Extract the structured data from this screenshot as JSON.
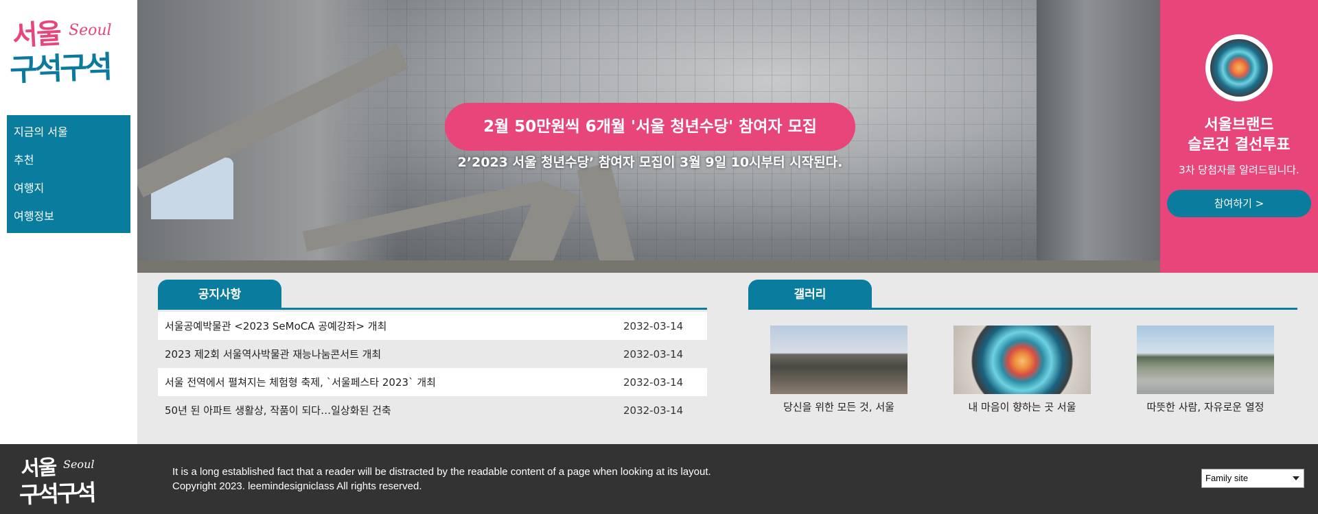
{
  "brand": {
    "logo_line1": "서울",
    "logo_line1_latin": "Seoul",
    "logo_line2": "구석구석"
  },
  "nav": {
    "items": [
      {
        "label": "지금의 서울"
      },
      {
        "label": "추천"
      },
      {
        "label": "여행지"
      },
      {
        "label": "여행정보"
      }
    ]
  },
  "hero": {
    "title": "2월 50만원씩 6개월 '서울 청년수당' 참여자 모집",
    "subtitle": "2’2023 서울 청년수당’ 참여자 모집이 3월 9일 10시부터 시작된다."
  },
  "promo": {
    "title_line1": "서울브랜드",
    "title_line2": "슬로건 결선투표",
    "description": "3차 당첨자를 알려드립니다.",
    "button_label": "참여하기 >"
  },
  "notice": {
    "tab_label": "공지사항",
    "items": [
      {
        "title": "서울공예박물관 <2023 SeMoCA 공예강좌> 개최",
        "date": "2032-03-14"
      },
      {
        "title": "2023 제2회 서울역사박물관 재능나눔콘서트 개최",
        "date": "2032-03-14"
      },
      {
        "title": "서울 전역에서 펼쳐지는 체험형 축제, `서울페스타 2023` 개최",
        "date": "2032-03-14"
      },
      {
        "title": "50년 된 아파트 생활상, 작품이 되다…일상화된 건축",
        "date": "2032-03-14"
      }
    ]
  },
  "gallery": {
    "tab_label": "갤러리",
    "items": [
      {
        "caption": "당신을 위한 모든 것, 서울"
      },
      {
        "caption": "내 마음이 향하는 곳 서울"
      },
      {
        "caption": "따뜻한 사람, 자유로운 열정"
      }
    ]
  },
  "footer": {
    "line1": "It is a long established fact that a reader will be distracted by the readable content of a page when looking at its layout.",
    "line2": "Copyright 2023. leemindesigniclass All rights reserved.",
    "family_site_label": "Family site"
  },
  "colors": {
    "teal": "#0a7d9f",
    "pink": "#e8457b",
    "footer_bg": "#333333",
    "content_bg": "#e9e9e9"
  }
}
